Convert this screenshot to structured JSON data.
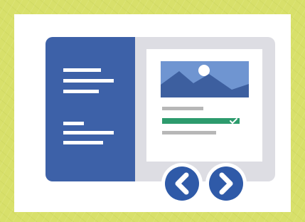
{
  "scene": {
    "background_color": "#d8e06a",
    "card_color": "#ffffff",
    "illustration": {
      "sidebar_color": "#3d61a8",
      "sidebar_lines_color": "#ffffff",
      "device_color": "#dddde3",
      "screen_color": "#ffffff",
      "image_placeholder_color": "#6f95d1",
      "image_sun_color": "#ffffff",
      "image_mountain_color": "#3d5f9f",
      "text_line_color": "#b7b7b7",
      "selected_line_color": "#2d9b6d",
      "check_color": "#ffffff",
      "nav_button_color": "#2f5aa8",
      "nav_arrow_color": "#ffffff",
      "icons": [
        "document-sidebar-icon",
        "image-placeholder-icon",
        "checkmark-icon",
        "chevron-left-icon",
        "chevron-right-icon"
      ]
    }
  }
}
